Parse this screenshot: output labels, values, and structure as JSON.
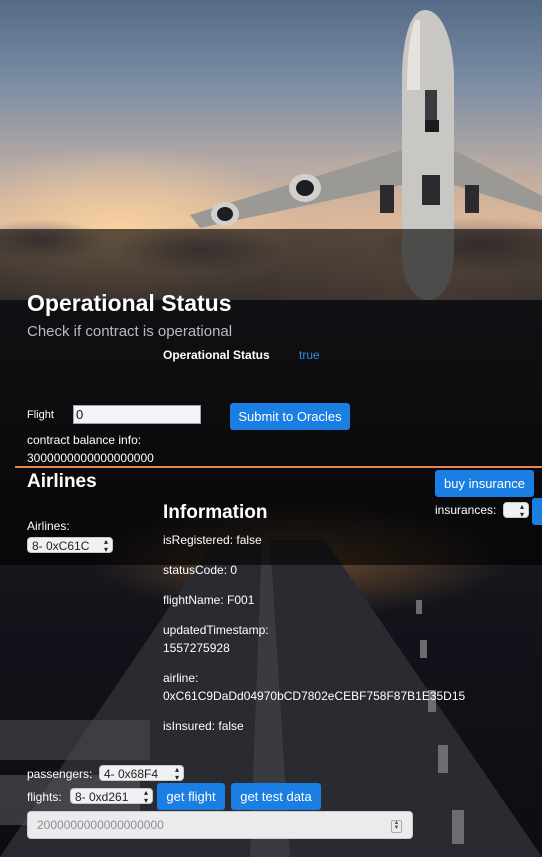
{
  "operational": {
    "title": "Operational Status",
    "subtitle": "Check if contract is operational",
    "status_label": "Operational Status",
    "status_value": "true"
  },
  "oracle": {
    "flight_label": "Flight",
    "flight_value": "0",
    "submit_label": "Submit to Oracles",
    "balance_label": "contract balance info:",
    "balance_value": "3000000000000000000"
  },
  "airlines": {
    "title": "Airlines",
    "label": "Airlines:",
    "selected": "8- 0xC61C"
  },
  "insurance": {
    "buy_label": "buy insurance",
    "insurances_label": "insurances:"
  },
  "information": {
    "title": "Information",
    "isRegistered": "isRegistered: false",
    "statusCode": "statusCode: 0",
    "flightName": "flightName: F001",
    "updatedTimestamp_label": "updatedTimestamp:",
    "updatedTimestamp_value": "1557275928",
    "airline_label": "airline:",
    "airline_value": "0xC61C9DaDd04970bCD7802eCEBF758F87B1E35D15",
    "isInsured": "isInsured: false"
  },
  "passengers": {
    "label": "passengers:",
    "selected": "4- 0x68F4"
  },
  "flights": {
    "label": "flights:",
    "selected": "8- 0xd261",
    "get_flight_label": "get flight",
    "get_test_data_label": "get test data"
  },
  "amount": {
    "value": "2000000000000000000"
  },
  "colors": {
    "accent": "#1a7ee3",
    "divider": "#e88451",
    "status_true": "#2e8fd9"
  }
}
